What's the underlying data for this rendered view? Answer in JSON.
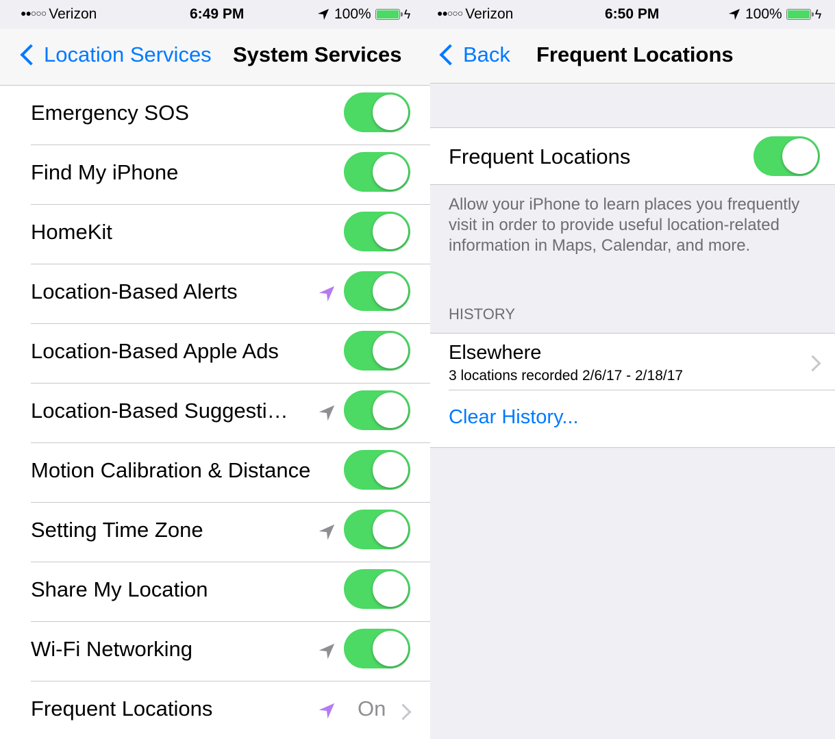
{
  "left": {
    "status": {
      "carrier_dots": "●●○○○",
      "carrier": "Verizon",
      "time": "6:49 PM",
      "battery": "100%"
    },
    "nav": {
      "back_label": "Location Services",
      "title": "System Services"
    },
    "rows": [
      {
        "label": "Emergency SOS"
      },
      {
        "label": "Find My iPhone"
      },
      {
        "label": "HomeKit"
      },
      {
        "label": "Location-Based Alerts"
      },
      {
        "label": "Location-Based Apple Ads"
      },
      {
        "label": "Location-Based Suggesti…"
      },
      {
        "label": "Motion Calibration & Distance"
      },
      {
        "label": "Setting Time Zone"
      },
      {
        "label": "Share My Location"
      },
      {
        "label": "Wi-Fi Networking"
      },
      {
        "label": "Frequent Locations",
        "value": "On"
      }
    ],
    "colors": {
      "toggle_on": "#4cd964",
      "arrow_purple": "#b57bf0",
      "arrow_gray": "#8e8e93"
    }
  },
  "right": {
    "status": {
      "carrier_dots": "●●○○○",
      "carrier": "Verizon",
      "time": "6:50 PM",
      "battery": "100%"
    },
    "nav": {
      "back_label": "Back",
      "title": "Frequent Locations"
    },
    "toggle_row": {
      "label": "Frequent Locations"
    },
    "description": "Allow your iPhone to learn places you frequently visit in order to provide useful location-related information in Maps, Calendar, and more.",
    "history_header": "HISTORY",
    "history_item": {
      "title": "Elsewhere",
      "subtitle": "3 locations recorded 2/6/17 - 2/18/17"
    },
    "clear_history": "Clear History..."
  }
}
